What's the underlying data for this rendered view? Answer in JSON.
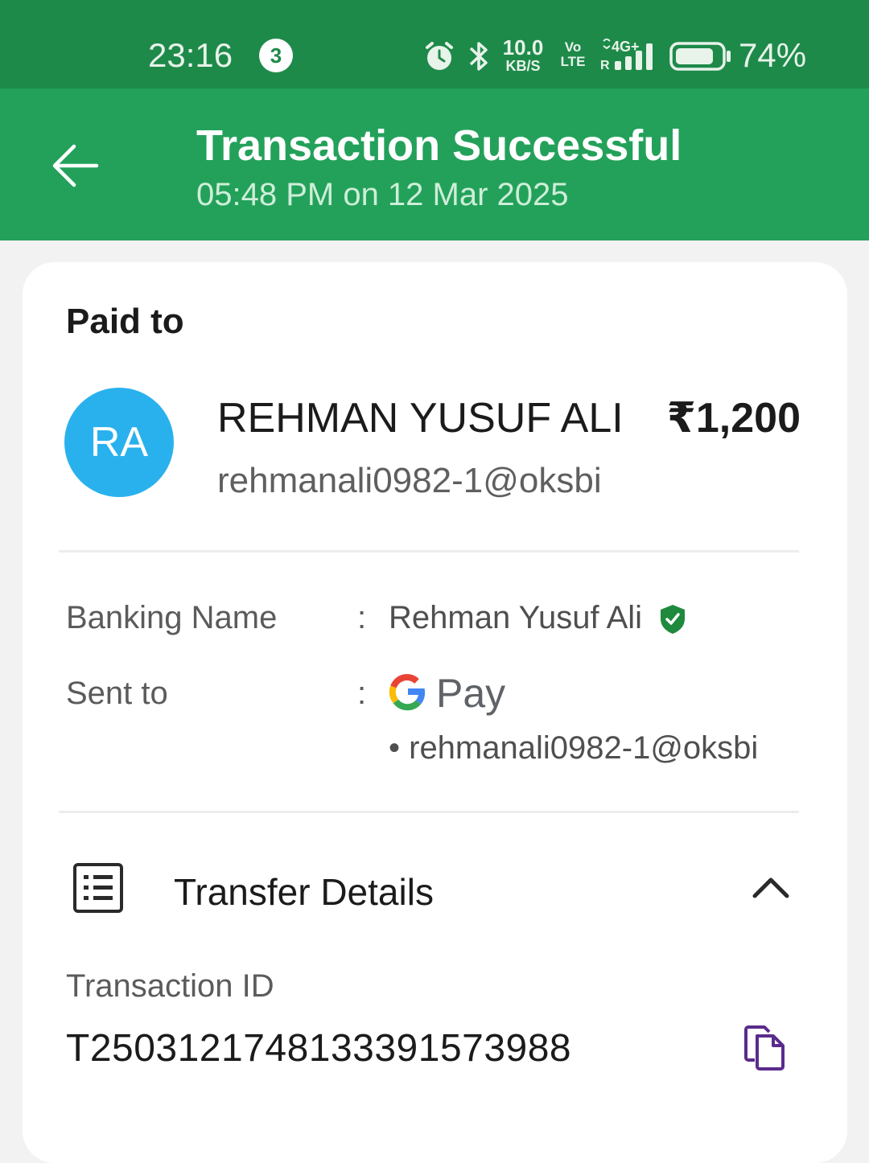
{
  "status_bar": {
    "time": "23:16",
    "notification_count": "3",
    "net_speed": "10.0",
    "net_speed_unit": "KB/S",
    "volte_line1": "Vo",
    "volte_line2": "LTE",
    "network_type": "4G+",
    "roaming": "R",
    "battery": "74%",
    "icons": [
      "alarm-icon",
      "bluetooth-icon",
      "signal-icon",
      "battery-icon"
    ]
  },
  "header": {
    "title": "Transaction Successful",
    "subtitle": "05:48 PM on 12 Mar 2025",
    "back_icon": "arrow-left-icon"
  },
  "payment": {
    "paid_to_label": "Paid to",
    "avatar_initials": "RA",
    "payee_name": "REHMAN YUSUF ALI",
    "amount": "₹1,200",
    "payee_upi": "rehmanali0982-1@oksbi"
  },
  "details": {
    "banking_name_label": "Banking Name",
    "banking_name_value": "Rehman Yusuf Ali",
    "sent_to_label": "Sent to",
    "sent_to_app": "Pay",
    "sent_to_upi": "• rehmanali0982-1@oksbi",
    "colon": ":"
  },
  "transfer": {
    "section_label": "Transfer Details",
    "txn_id_label": "Transaction ID",
    "txn_id": "T2503121748133391573988"
  },
  "colors": {
    "status_bar": "#1e8a4a",
    "app_bar": "#23a15a",
    "avatar": "#29b1ed",
    "verified": "#1f8a3d",
    "copy_icon": "#5a2b8c"
  }
}
